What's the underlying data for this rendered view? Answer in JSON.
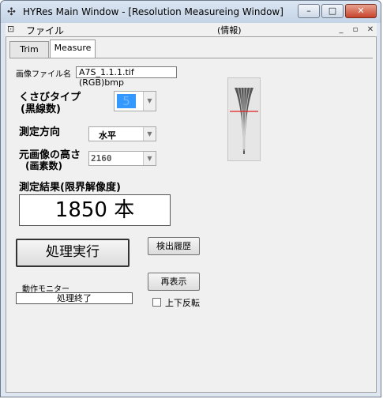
{
  "window": {
    "title": "HYRes Main Window - [Resolution Measureing Window]",
    "controls": {
      "minimize": "–",
      "maximize": "□",
      "close": "✕"
    }
  },
  "menubar": {
    "file_label": "ファイル",
    "center_label": "(情報)",
    "mdi_controls": {
      "minimize": "_",
      "restore": "▫",
      "close": "✕"
    }
  },
  "tabs": [
    {
      "label": "Trim"
    },
    {
      "label": "Measure"
    }
  ],
  "measure": {
    "image_file_label": "画像ファイル名",
    "image_file_value": "A7S_1.1.1.tif (RGB)bmp",
    "wedge_type_label_1": "くさびタイプ",
    "wedge_type_label_2": "(黒線数)",
    "wedge_type_value": "5",
    "direction_label": "測定方向",
    "direction_value": "水平",
    "height_label_1": "元画像の高さ",
    "height_label_2": "(画素数)",
    "height_value": "2160",
    "result_label": "測定結果(限界解像度)",
    "result_value": "1850 本",
    "run_button": "処理実行",
    "history_button": "検出履歴",
    "redisplay_button": "再表示",
    "flip_label": "上下反転",
    "flip_checked": false,
    "monitor_label": "動作モニター",
    "monitor_value": "処理終了"
  },
  "colors": {
    "selection": "#3399ff",
    "wedge_line": "#e02020"
  }
}
